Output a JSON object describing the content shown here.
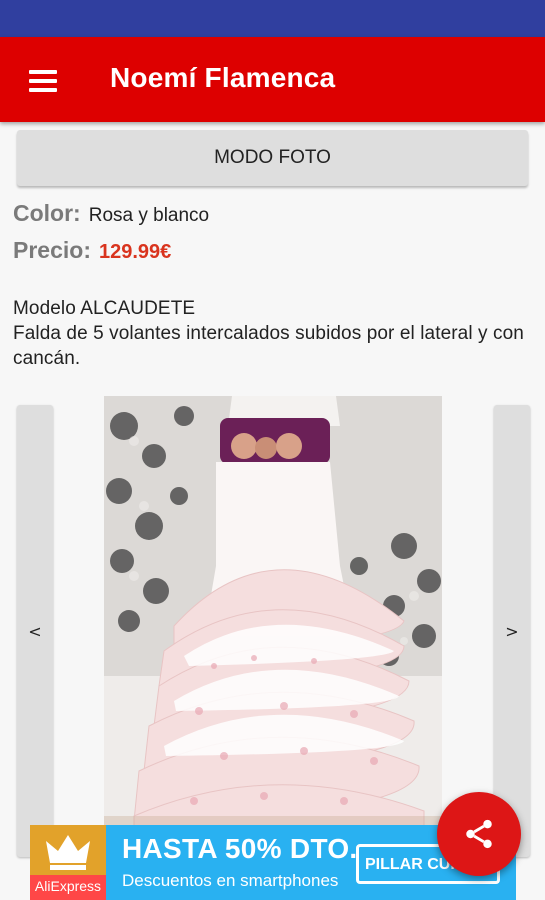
{
  "app": {
    "title": "Noemí Flamenca",
    "menu_icon": "menu-icon"
  },
  "toolbar": {
    "photo_mode_label": "MODO FOTO"
  },
  "product": {
    "color_label": "Color:",
    "color_value": "Rosa y blanco",
    "price_label": "Precio:",
    "price_value": "129.99€",
    "description_line1": "Modelo ALCAUDETE",
    "description_line2": "Falda de 5 volantes intercalados subidos por el lateral y con cancán."
  },
  "gallery": {
    "prev_label": "<",
    "next_label": ">",
    "image_icon": "flamenco-skirt-photo"
  },
  "fab": {
    "icon": "share-icon",
    "color": "#dd1616"
  },
  "ad": {
    "brand": "AliExpress",
    "headline": "HASTA 50% DTO.",
    "subline": "Descuentos en smartphones",
    "cta": "PILLAR CUPÓN",
    "color": "#29b1f1"
  },
  "colors": {
    "status_bar": "#303f9f",
    "app_bar": "#dd0000",
    "price": "#d9341e",
    "label": "#7a7a7a"
  }
}
